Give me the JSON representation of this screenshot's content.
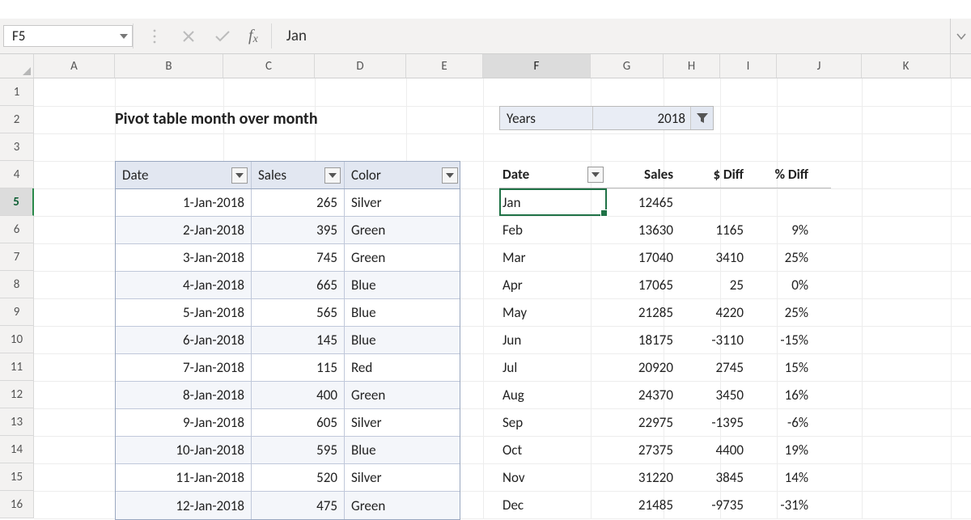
{
  "namebox": "F5",
  "formula": "Jan",
  "columns": [
    "A",
    "B",
    "C",
    "D",
    "E",
    "F",
    "G",
    "H",
    "I",
    "J",
    "K"
  ],
  "selected_col": "F",
  "rows": [
    1,
    2,
    3,
    4,
    5,
    6,
    7,
    8,
    9,
    10,
    11,
    12,
    13,
    14,
    15,
    16
  ],
  "selected_row": 5,
  "title": "Pivot table month over month",
  "slicer": {
    "label": "Years",
    "value": "2018"
  },
  "table": {
    "headers": [
      "Date",
      "Sales",
      "Color"
    ],
    "rows": [
      {
        "date": "1-Jan-2018",
        "sales": "265",
        "color": "Silver"
      },
      {
        "date": "2-Jan-2018",
        "sales": "395",
        "color": "Green"
      },
      {
        "date": "3-Jan-2018",
        "sales": "745",
        "color": "Green"
      },
      {
        "date": "4-Jan-2018",
        "sales": "665",
        "color": "Blue"
      },
      {
        "date": "5-Jan-2018",
        "sales": "565",
        "color": "Blue"
      },
      {
        "date": "6-Jan-2018",
        "sales": "145",
        "color": "Blue"
      },
      {
        "date": "7-Jan-2018",
        "sales": "115",
        "color": "Red"
      },
      {
        "date": "8-Jan-2018",
        "sales": "400",
        "color": "Green"
      },
      {
        "date": "9-Jan-2018",
        "sales": "605",
        "color": "Silver"
      },
      {
        "date": "10-Jan-2018",
        "sales": "595",
        "color": "Blue"
      },
      {
        "date": "11-Jan-2018",
        "sales": "520",
        "color": "Silver"
      },
      {
        "date": "12-Jan-2018",
        "sales": "475",
        "color": "Green"
      }
    ]
  },
  "pivot": {
    "headers": {
      "date": "Date",
      "sales": "Sales",
      "diff": "$ Diff",
      "pdiff": "% Diff"
    },
    "rows": [
      {
        "month": "Jan",
        "sales": "12465",
        "diff": "",
        "pdiff": ""
      },
      {
        "month": "Feb",
        "sales": "13630",
        "diff": "1165",
        "pdiff": "9%"
      },
      {
        "month": "Mar",
        "sales": "17040",
        "diff": "3410",
        "pdiff": "25%"
      },
      {
        "month": "Apr",
        "sales": "17065",
        "diff": "25",
        "pdiff": "0%"
      },
      {
        "month": "May",
        "sales": "21285",
        "diff": "4220",
        "pdiff": "25%"
      },
      {
        "month": "Jun",
        "sales": "18175",
        "diff": "-3110",
        "pdiff": "-15%"
      },
      {
        "month": "Jul",
        "sales": "20920",
        "diff": "2745",
        "pdiff": "15%"
      },
      {
        "month": "Aug",
        "sales": "24370",
        "diff": "3450",
        "pdiff": "16%"
      },
      {
        "month": "Sep",
        "sales": "22975",
        "diff": "-1395",
        "pdiff": "-6%"
      },
      {
        "month": "Oct",
        "sales": "27375",
        "diff": "4400",
        "pdiff": "19%"
      },
      {
        "month": "Nov",
        "sales": "31220",
        "diff": "3845",
        "pdiff": "14%"
      },
      {
        "month": "Dec",
        "sales": "21485",
        "diff": "-9735",
        "pdiff": "-31%"
      }
    ]
  }
}
